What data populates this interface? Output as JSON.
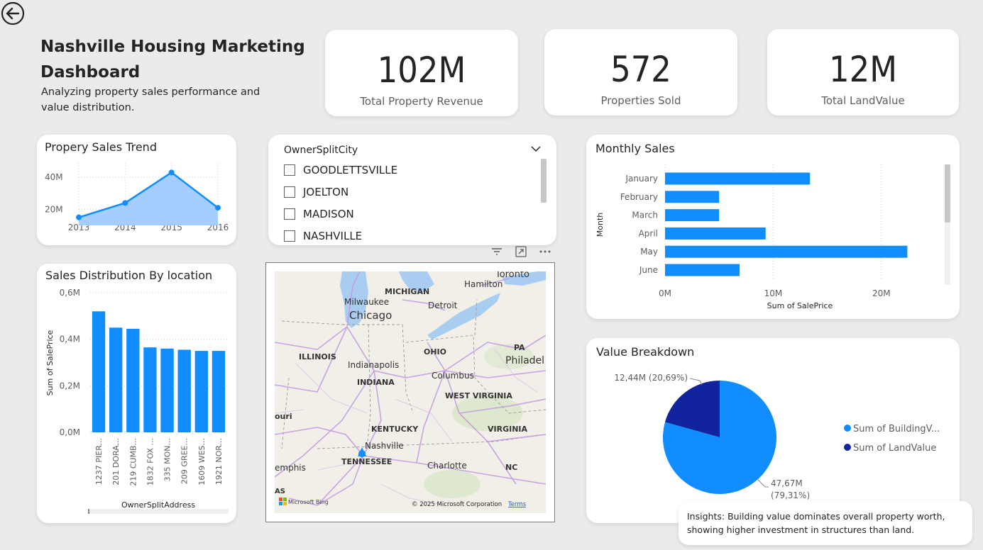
{
  "back_button_label": "back",
  "header": {
    "title_line1": "Nashville Housing Marketing",
    "title_line2": "Dashboard",
    "subtitle_line1": "Analyzing property sales performance and",
    "subtitle_line2": "value distribution."
  },
  "kpis": [
    {
      "value": "102M",
      "label": "Total Property Revenue"
    },
    {
      "value": "572",
      "label": "Properties Sold"
    },
    {
      "value": "12M",
      "label": "Total LandValue"
    }
  ],
  "sales_trend": {
    "title": "Propery Sales Trend"
  },
  "slicer": {
    "title": "OwnerSplitCity",
    "items": [
      "GOODLETTSVILLE",
      "JOELTON",
      "MADISON",
      "NASHVILLE"
    ]
  },
  "monthly_sales": {
    "title": "Monthly Sales"
  },
  "distribution": {
    "title": "Sales Distribution By location"
  },
  "map": {
    "labels": [
      "MICHIGAN",
      "Milwaukee",
      "Chicago",
      "Detroit",
      "Hamilton",
      "Toronto",
      "ILLINOIS",
      "OHIO",
      "PA",
      "Philadel",
      "Indianapolis",
      "INDIANA",
      "Columbus",
      "WEST VIRGINIA",
      "KENTUCKY",
      "VIRGINIA",
      "Nashville",
      "TENNESSEE",
      "Charlotte",
      "NC",
      "ouri",
      "emphis",
      "AS"
    ],
    "bing_label": "Microsoft Bing",
    "copyright": "© 2025 Microsoft Corporation",
    "terms": "Terms"
  },
  "value_breakdown": {
    "title": "Value Breakdown",
    "label_small": "12,44M (20,69%)",
    "label_large_line1": "47,67M",
    "label_large_line2": "(79,31%)"
  },
  "insight": {
    "line1": "Insights: Building value dominates overall property worth,",
    "line2": "showing higher investment in structures than land."
  },
  "colors": {
    "primary": "#118dff",
    "dark": "#12239e",
    "area": "#9ecbff"
  },
  "chart_data": [
    {
      "type": "area",
      "title": "Propery Sales Trend",
      "x": [
        "2013",
        "2014",
        "2015",
        "2016"
      ],
      "values": [
        15,
        24,
        43,
        21
      ],
      "ylabel_unit": "M",
      "yticks": [
        "20M",
        "40M"
      ],
      "ylim": [
        10,
        48
      ]
    },
    {
      "type": "bar",
      "orientation": "horizontal",
      "title": "Monthly Sales",
      "categories": [
        "January",
        "February",
        "March",
        "April",
        "May",
        "June"
      ],
      "values": [
        13.4,
        5.0,
        5.0,
        9.3,
        22.4,
        6.9
      ],
      "xlabel": "Sum of SalePrice",
      "ylabel": "Month",
      "xticks": [
        "0M",
        "10M",
        "20M"
      ],
      "xlim": [
        0,
        25
      ]
    },
    {
      "type": "bar",
      "title": "Sales Distribution By location",
      "categories": [
        "1237 PIER...",
        "201 DORA...",
        "219 CUMB...",
        "1832 FOX ...",
        "335 MON...",
        "209 GREE...",
        "1609 WES...",
        "1921 NOR..."
      ],
      "values": [
        0.52,
        0.45,
        0.445,
        0.365,
        0.36,
        0.355,
        0.35,
        0.35
      ],
      "xlabel": "OwnerSplitAddress",
      "ylabel": "Sum of SalePrice",
      "yticks": [
        "0,0M",
        "0,2M",
        "0,4M",
        "0,6M"
      ],
      "ylim": [
        0,
        0.6
      ]
    },
    {
      "type": "pie",
      "title": "Value Breakdown",
      "slices": [
        {
          "name": "Sum of BuildingV...",
          "value": 47.67,
          "percent": 79.31,
          "color": "#118dff"
        },
        {
          "name": "Sum of LandValue",
          "value": 12.44,
          "percent": 20.69,
          "color": "#12239e"
        }
      ]
    }
  ]
}
